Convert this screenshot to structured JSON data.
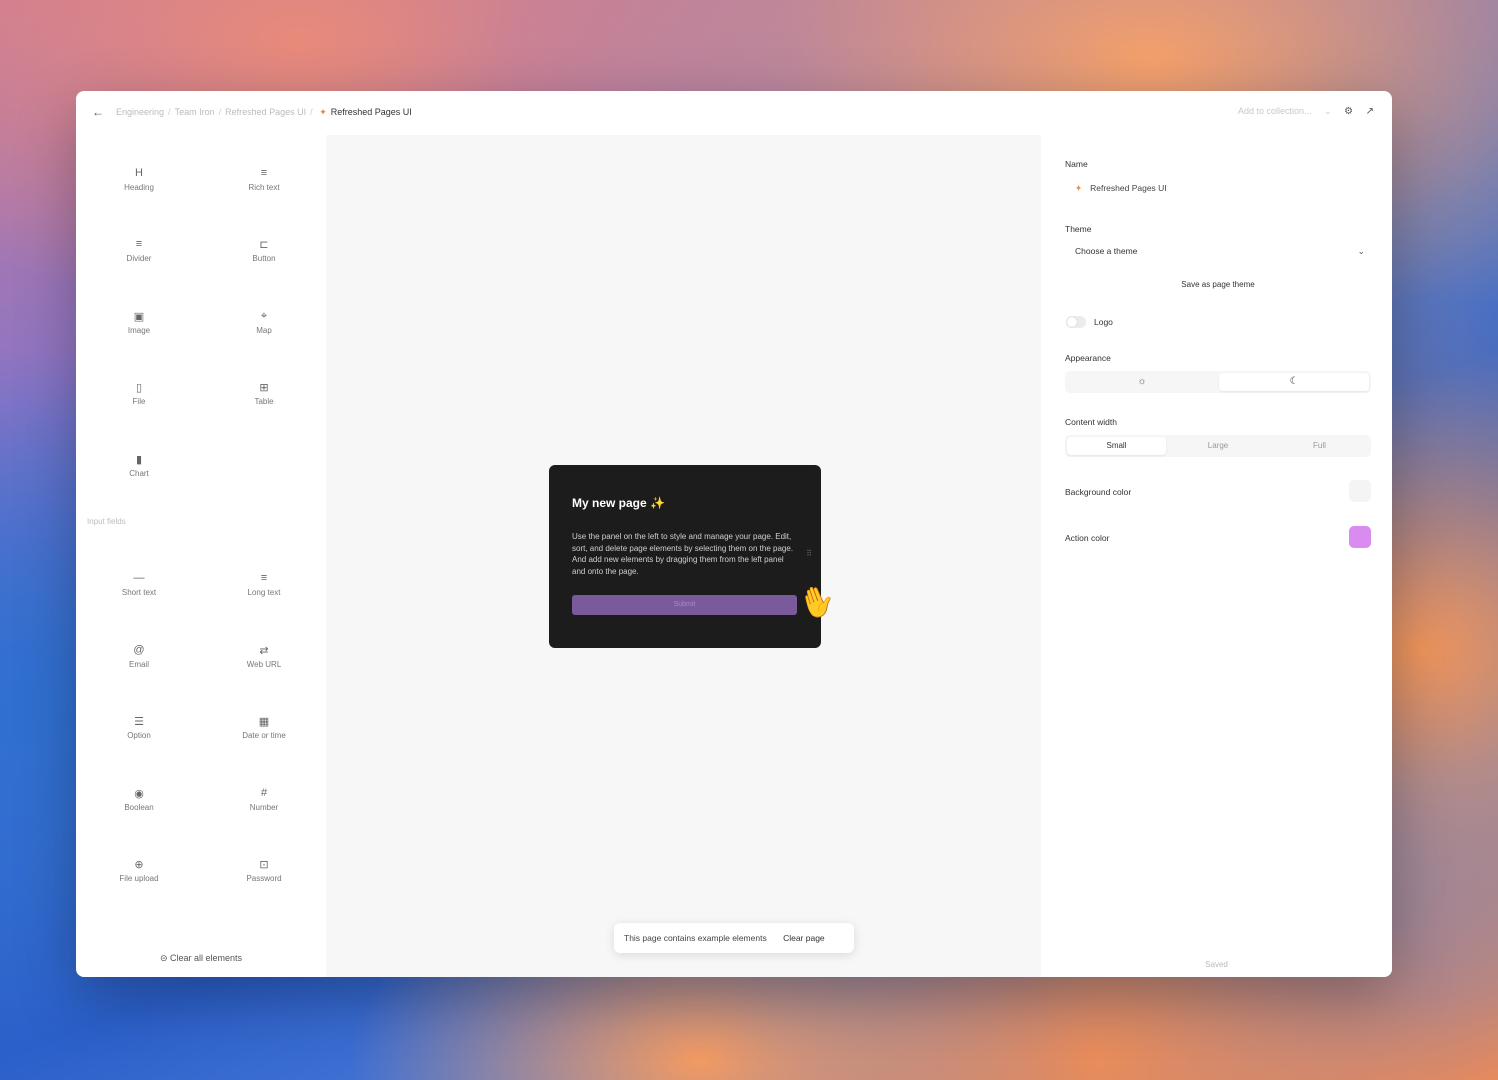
{
  "breadcrumb": {
    "items": [
      "Engineering",
      "Team Iron",
      "Refreshed Pages UI"
    ],
    "current": "Refreshed Pages UI"
  },
  "header": {
    "add_to_collection": "Add to collection..."
  },
  "elements_panel": {
    "tiles": [
      {
        "label": "Heading",
        "icon": "heading-icon",
        "glyph": "H"
      },
      {
        "label": "Rich text",
        "icon": "rich-text-icon",
        "glyph": "≡"
      },
      {
        "label": "Divider",
        "icon": "divider-icon",
        "glyph": "≡"
      },
      {
        "label": "Button",
        "icon": "button-icon",
        "glyph": "⊏"
      },
      {
        "label": "Image",
        "icon": "image-icon",
        "glyph": "▣"
      },
      {
        "label": "Map",
        "icon": "map-pin-icon",
        "glyph": "⌖"
      },
      {
        "label": "File",
        "icon": "file-icon",
        "glyph": "▯"
      },
      {
        "label": "Table",
        "icon": "table-icon",
        "glyph": "⊞"
      },
      {
        "label": "Chart",
        "icon": "chart-icon",
        "glyph": "▮"
      }
    ],
    "input_fields_label": "Input fields",
    "input_tiles": [
      {
        "label": "Short text",
        "icon": "short-text-icon",
        "glyph": "—"
      },
      {
        "label": "Long text",
        "icon": "long-text-icon",
        "glyph": "≡"
      },
      {
        "label": "Email",
        "icon": "at-sign-icon",
        "glyph": "@"
      },
      {
        "label": "Web URL",
        "icon": "link-icon",
        "glyph": "⇄"
      },
      {
        "label": "Option",
        "icon": "option-list-icon",
        "glyph": "☰"
      },
      {
        "label": "Date or time",
        "icon": "calendar-icon",
        "glyph": "▦"
      },
      {
        "label": "Boolean",
        "icon": "boolean-icon",
        "glyph": "◉"
      },
      {
        "label": "Number",
        "icon": "hash-icon",
        "glyph": "#"
      },
      {
        "label": "File upload",
        "icon": "upload-icon",
        "glyph": "⊕"
      },
      {
        "label": "Password",
        "icon": "lock-icon",
        "glyph": "⊡"
      }
    ],
    "clear_all": "Clear all elements"
  },
  "canvas": {
    "card_title": "My new page",
    "card_body": "Use the panel on the left to style and manage your page. Edit, sort, and delete page elements by selecting them on the page. And add new elements by dragging them from the left panel and onto the page.",
    "card_button": "Submit",
    "toast_message": "This page contains example elements",
    "toast_action": "Clear page"
  },
  "settings": {
    "name_label": "Name",
    "name_value": "Refreshed Pages UI",
    "theme_label": "Theme",
    "theme_placeholder": "Choose a theme",
    "save_theme": "Save as page theme",
    "logo_label": "Logo",
    "logo_enabled": false,
    "appearance_label": "Appearance",
    "appearance_selected": "dark",
    "content_width_label": "Content width",
    "content_width_options": [
      "Small",
      "Large",
      "Full"
    ],
    "content_width_selected": "Small",
    "background_color_label": "Background color",
    "background_color": "#f4f4f4",
    "action_color_label": "Action color",
    "action_color": "#d98bf0",
    "saved_status": "Saved"
  }
}
